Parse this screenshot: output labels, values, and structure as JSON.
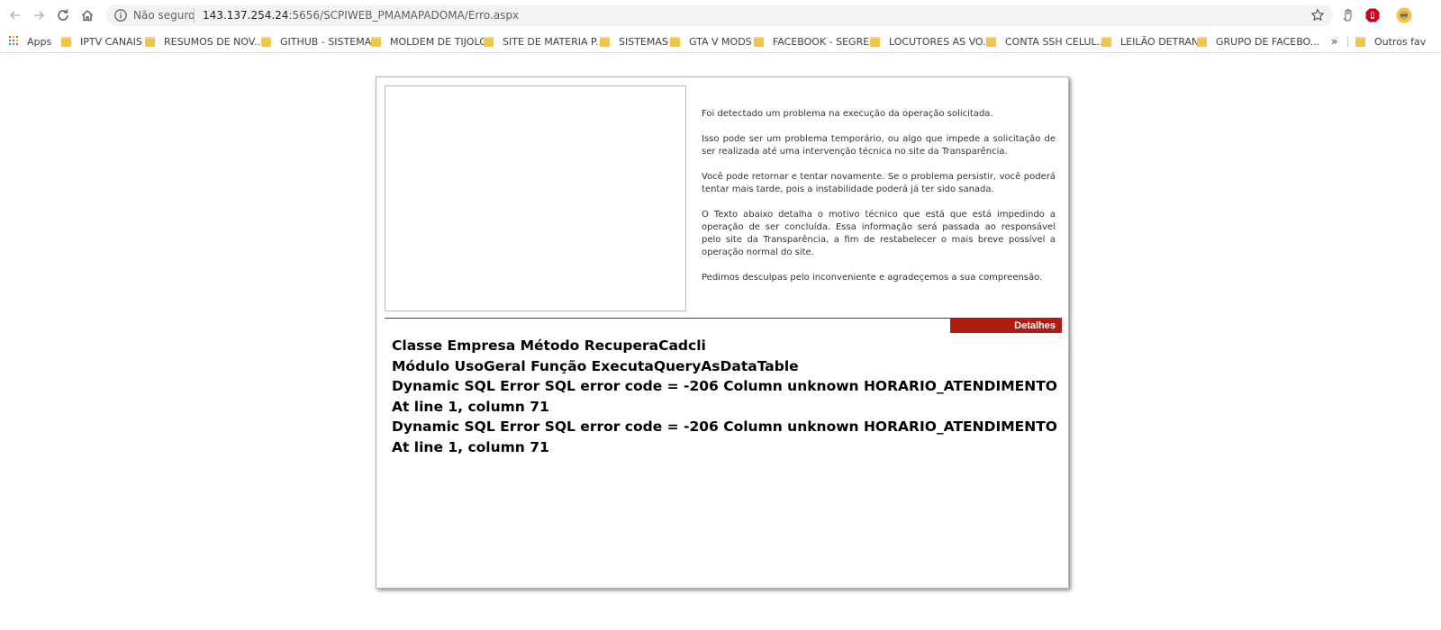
{
  "browser": {
    "security_label": "Não seguro",
    "url_host": "143.137.254.24",
    "url_path": ":5656/SCPIWEB_PMAMAPADOMA/Erro.aspx"
  },
  "bookmarks": {
    "apps_label": "Apps",
    "items": [
      "IPTV CANAIS",
      "RESUMOS DE NOV...",
      "GITHUB - SISTEMAS",
      "MOLDEM DE TIJOLO",
      "SITE DE MATERIA P...",
      "SISTEMAS",
      "GTA V MODS",
      "FACEBOOK - SEGRE...",
      "LOCUTORES AS VO...",
      "CONTA SSH CELUL...",
      "LEILÃO DETRAN",
      "GRUPO DE FACEBO..."
    ],
    "overflow_label": "»",
    "other_label": "Outros fav"
  },
  "page": {
    "messages": [
      "Foi detectado um problema na execução da operação solicitada.",
      "Isso pode ser um problema temporário, ou algo que impede a solicitação de ser realizada até uma intervenção técnica no site da Transparência.",
      "Você pode retornar e tentar novamente. Se o problema persistir, você poderá tentar mais tarde, pois a instabilidade poderá já ter sido sanada.",
      "O Texto abaixo detalha o motivo técnico que está que está impedindo a operação de ser concluída. Essa informação será passada ao responsável pelo site da Transparência, a fim de restabelecer o mais breve possível a operação normal do site.",
      "Pedimos desculpas pelo inconveniente e agradeçemos a sua compreensão."
    ],
    "details_label": "Detalhes",
    "error_lines": [
      "Classe Empresa Método RecuperaCadcli",
      "Módulo UsoGeral Função ExecutaQueryAsDataTable",
      "Dynamic SQL Error SQL error code = -206 Column unknown HORARIO_ATENDIMENTO At line 1, column 71",
      "Dynamic SQL Error SQL error code = -206 Column unknown HORARIO_ATENDIMENTO At line 1, column 71"
    ]
  },
  "colors": {
    "accent_red": "#b01c12",
    "folder_yellow": "#f4c542"
  }
}
